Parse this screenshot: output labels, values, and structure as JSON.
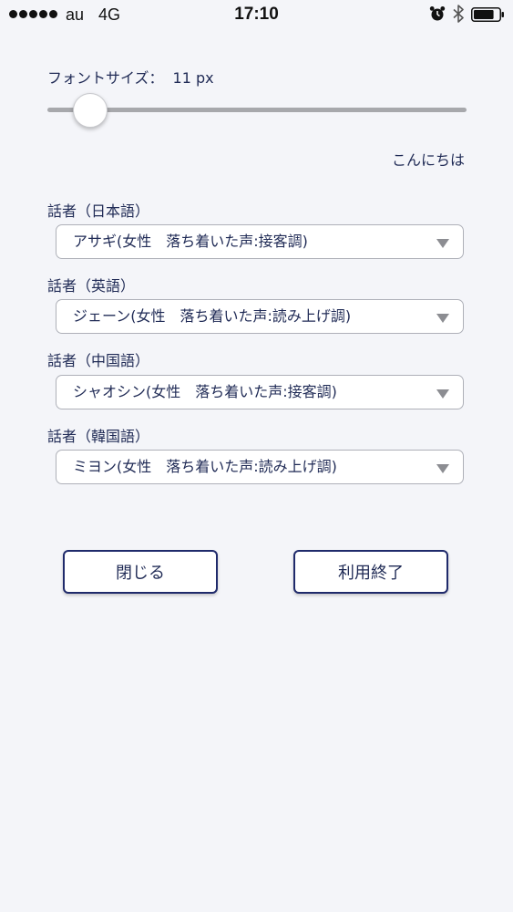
{
  "status_bar": {
    "carrier": "au",
    "network": "4G",
    "time": "17:10",
    "signal_bars": 5,
    "battery_level": 0.8
  },
  "font_size": {
    "label": "フォントサイズ：",
    "value": "11 px",
    "slider_level": 0.1,
    "preview_text": "こんにちは"
  },
  "speakers": [
    {
      "label": "話者（日本語）",
      "selected": "アサギ(女性　落ち着いた声:接客調)"
    },
    {
      "label": "話者（英語）",
      "selected": "ジェーン(女性　落ち着いた声:読み上げ調)"
    },
    {
      "label": "話者（中国語）",
      "selected": "シャオシン(女性　落ち着いた声:接客調)"
    },
    {
      "label": "話者（韓国語）",
      "selected": "ミヨン(女性　落ち着いた声:読み上げ調)"
    }
  ],
  "buttons": {
    "close_label": "閉じる",
    "end_label": "利用終了"
  },
  "colors": {
    "background": "#f4f5f9",
    "text": "#1f2a55",
    "button_border": "#1f2a6b",
    "slider_track": "#a7a8ac"
  },
  "icons": {
    "alarm": "alarm-icon",
    "bluetooth": "bluetooth-icon",
    "battery": "battery-icon",
    "dropdown": "chevron-down-icon"
  }
}
